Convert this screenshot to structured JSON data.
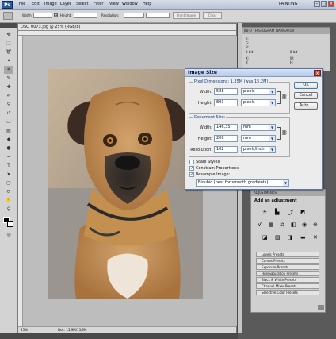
{
  "app": {
    "logo": "Ps",
    "menu": [
      "File",
      "Edit",
      "Image",
      "Layer",
      "Select",
      "Filter",
      "View",
      "Window",
      "Help"
    ],
    "workspace": "PAINTING"
  },
  "options_bar": {
    "width_label": "Width:",
    "height_label": "Height:",
    "resolution_label": "Resolution:",
    "front_image_btn": "Front Image",
    "clear_btn": "Clear"
  },
  "document": {
    "tab_title": "DSC_0073.jpg @ 25% (RGB/8)",
    "zoom": "25%",
    "doc_size": "Doc: 15,9M/15,9M"
  },
  "info_panel": {
    "tabs": [
      "INFO",
      "HISTOGRAM",
      "NAVIGATOR"
    ],
    "r_label": "R:",
    "g_label": "G:",
    "b_label": "B:",
    "x_label": "X:",
    "y_label": "Y:",
    "w_label": "W:",
    "h_label": "H:",
    "bit_left": "8-bit",
    "bit_right": "8-bit"
  },
  "adjustments": {
    "title": "ADJUSTMENTS",
    "subtitle": "Add an adjustment",
    "presets": [
      "Levels Presets",
      "Curves Presets",
      "Exposure Presets",
      "Hue/Saturation Presets",
      "Black & White Presets",
      "Channel Mixer Presets",
      "Selective Color Presets"
    ]
  },
  "dialog": {
    "title": "Image Size",
    "close": "x",
    "pixel_dim_label": "Pixel Dimensions:",
    "pixel_dim_value": "1,35M (was 15,2M)",
    "px_width_label": "Width:",
    "px_width_value": "588",
    "px_width_unit": "pixels",
    "px_height_label": "Height:",
    "px_height_value": "803",
    "px_height_unit": "pixels",
    "doc_size_label": "Document Size:",
    "doc_width_label": "Width:",
    "doc_width_value": "146,35",
    "doc_width_unit": "mm",
    "doc_height_label": "Height:",
    "doc_height_value": "200",
    "doc_height_unit": "mm",
    "resolution_label": "Resolution:",
    "resolution_value": "102",
    "resolution_unit": "pixels/inch",
    "scale_styles": "Scale Styles",
    "constrain": "Constrain Proportions",
    "resample": "Resample Image:",
    "resample_method": "Bicubic (best for smooth gradients)",
    "ok": "OK",
    "cancel": "Cancel",
    "auto": "Auto...",
    "scale_styles_checked": false,
    "constrain_checked": true,
    "resample_checked": true
  },
  "colors": {
    "dialog_title": "#b6c9e6",
    "group_label": "#123a8a",
    "close": "#c8402c"
  }
}
